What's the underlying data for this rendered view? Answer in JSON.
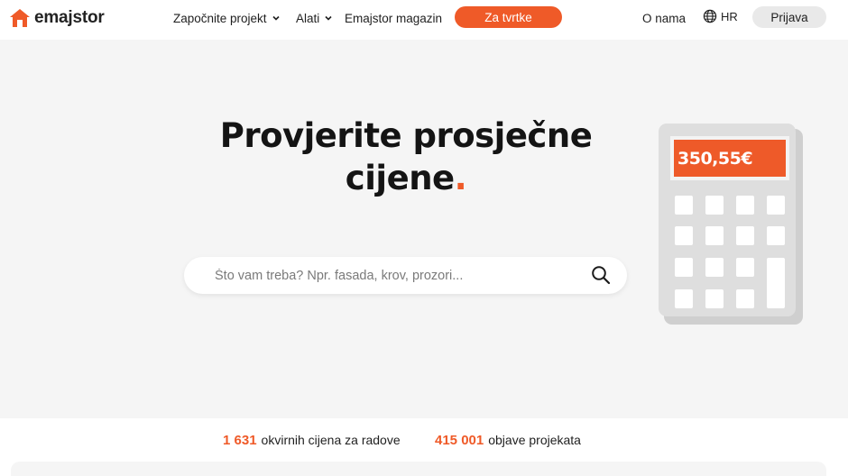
{
  "header": {
    "logo_text": "emajstor",
    "nav": {
      "start_project": "Započnite projekt",
      "tools": "Alati",
      "magazine": "Emajstor magazin"
    },
    "cta_label": "Za tvrtke",
    "about_label": "O nama",
    "language": "HR",
    "login_label": "Prijava"
  },
  "hero": {
    "title_line1": "Provjerite prosječne",
    "title_line2": "cijene",
    "title_dot": ".",
    "search_placeholder": "Što vam treba? Npr. fasada, krov, prozori...",
    "calculator_value": "350,55€"
  },
  "stats": [
    {
      "number": "1 631",
      "label": "okvirnih cijena za radove"
    },
    {
      "number": "415 001",
      "label": "objave projekata"
    }
  ],
  "colors": {
    "accent": "#ef5a28",
    "hero_bg": "#f5f5f5",
    "calculator_body": "#dedede",
    "login_bg": "#e9e9e9"
  },
  "icons": [
    "logo-house-icon",
    "chevron-down-icon",
    "globe-icon",
    "search-icon",
    "calculator-illustration"
  ]
}
